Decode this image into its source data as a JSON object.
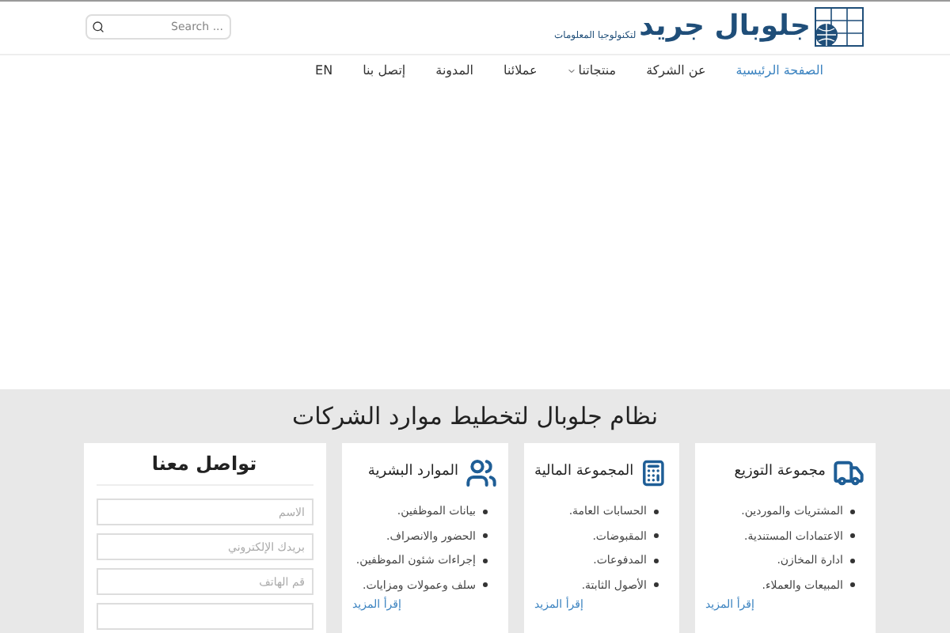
{
  "header": {
    "logo_title": "جلوبال جريد",
    "logo_subtitle": "لتكنولوجيا المعلومات",
    "search": {
      "placeholder": "Search ..."
    }
  },
  "nav": [
    {
      "label": "الصفحة الرئيسية",
      "selected": true
    },
    {
      "label": "عن الشركة",
      "selected": false
    },
    {
      "label": "منتجاتنا",
      "selected": false,
      "dropdown": true
    },
    {
      "label": "عملائنا",
      "selected": false
    },
    {
      "label": "المدونة",
      "selected": false
    },
    {
      "label": "إتصل بنا",
      "selected": false
    },
    {
      "label": "EN",
      "selected": false
    }
  ],
  "section": {
    "title": "نظام جلوبال لتخطيط موارد الشركات"
  },
  "cards": [
    {
      "kind": "truck",
      "title": "مجموعة التوزيع",
      "items": [
        "المشتريات والموردين.",
        "الاعتمادات المستندية.",
        "ادارة المخازن.",
        "المبيعات والعملاء."
      ],
      "link": "إقرأ المزيد"
    },
    {
      "kind": "calculator",
      "title": "المجموعة المالية",
      "items": [
        "الحسابات العامة.",
        "المقبوضات.",
        "المدفوعات.",
        "الأصول الثابتة."
      ],
      "link": "إقرأ المزيد"
    },
    {
      "kind": "people",
      "title": "الموارد البشرية",
      "items": [
        "بيانات الموظفين.",
        "الحضور والانصراف.",
        "إجراءات شئون الموظفين.",
        "سلف وعمولات ومزايات."
      ],
      "link": "إقرأ المزيد"
    }
  ],
  "contact": {
    "title": "تواصل معنا",
    "fields": [
      {
        "kind": "text",
        "placeholder": "الاسم"
      },
      {
        "kind": "text",
        "placeholder": "بريدك الإلكتروني"
      },
      {
        "kind": "text",
        "placeholder": "قم الهاتف"
      },
      {
        "kind": "text"
      }
    ]
  }
}
